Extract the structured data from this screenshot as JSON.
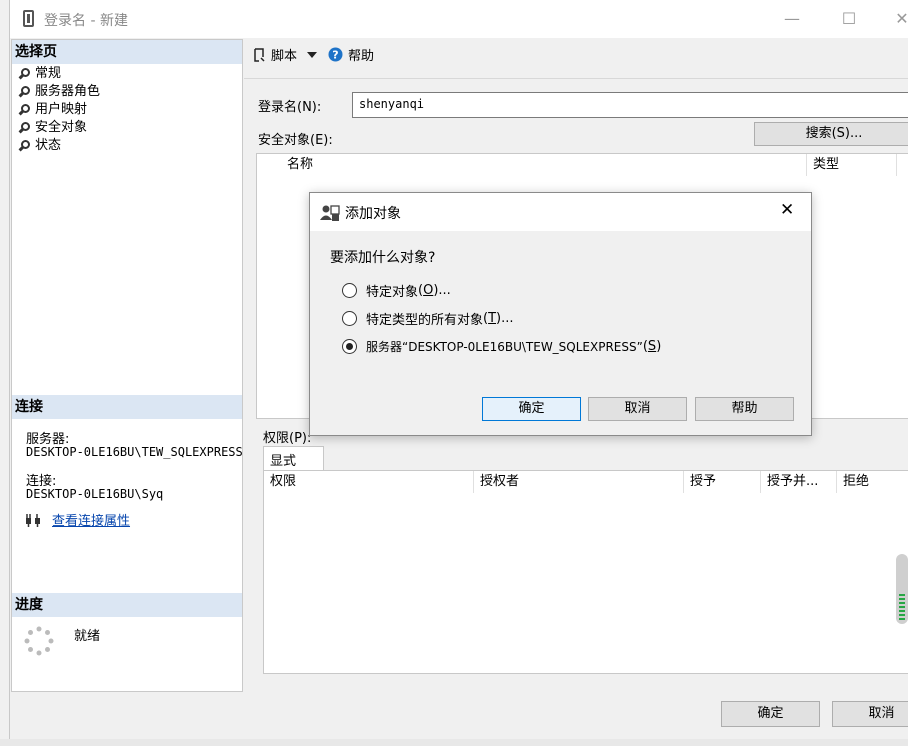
{
  "window": {
    "title": "登录名 - 新建",
    "minimize": "—",
    "maximize": "☐",
    "close": "✕"
  },
  "left_panel": {
    "select_page_header": "选择页",
    "pages": [
      {
        "label": "常规"
      },
      {
        "label": "服务器角色"
      },
      {
        "label": "用户映射"
      },
      {
        "label": "安全对象"
      },
      {
        "label": "状态"
      }
    ],
    "connection_header": "连接",
    "server_label": "服务器:",
    "server_value": "DESKTOP-0LE16BU\\TEW_SQLEXPRESS",
    "connection_label": "连接:",
    "connection_value": "DESKTOP-0LE16BU\\Syq",
    "view_connection_link": "查看连接属性",
    "progress_header": "进度",
    "progress_status": "就绪"
  },
  "toolbar": {
    "script_label": "脚本",
    "help_label": "帮助"
  },
  "form": {
    "login_name_label": "登录名(N):",
    "login_name_value": "shenyanqi",
    "securables_label": "安全对象(E):",
    "search_button": "搜索(S)...",
    "securables_columns": [
      "名称",
      "类型"
    ],
    "permissions_label": "权限(P):",
    "explicit_tab": "显式",
    "permissions_columns": [
      "权限",
      "授权者",
      "授予",
      "授予并...",
      "拒绝"
    ]
  },
  "footer": {
    "ok_button": "确定",
    "cancel_button": "取消"
  },
  "dialog": {
    "title": "添加对象",
    "question": "要添加什么对象?",
    "options": [
      {
        "text": "特定对象",
        "mnemonic": "O",
        "suffix": "...",
        "checked": false
      },
      {
        "text": "特定类型的所有对象",
        "mnemonic": "T",
        "suffix": "...",
        "checked": false
      },
      {
        "text": "服务器“DESKTOP-0LE16BU\\TEW_SQLEXPRESS”",
        "mnemonic": "S",
        "suffix": "",
        "checked": true
      }
    ],
    "ok_button": "确定",
    "cancel_button": "取消",
    "help_button": "帮助",
    "close": "✕"
  }
}
